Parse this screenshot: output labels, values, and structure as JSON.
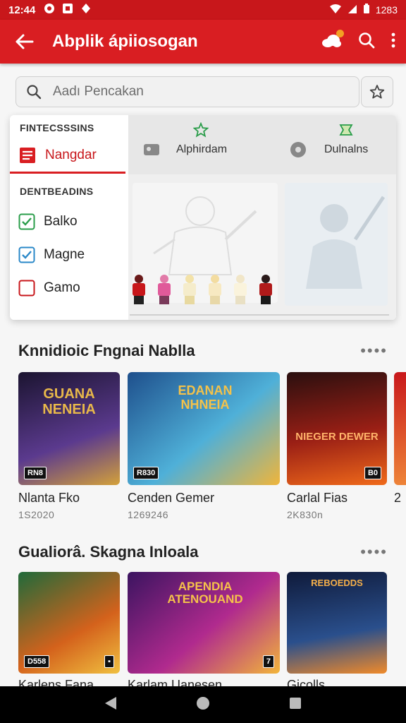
{
  "status": {
    "time": "12:44",
    "battery": "1283"
  },
  "appbar": {
    "title": "Abplik ápiiosogan"
  },
  "search": {
    "placeholder": "Aadı Pencakan"
  },
  "menu": {
    "section1": "FINTECSSSINS",
    "active_item": "Nangdar",
    "section2": "DENTBEADINS",
    "items": [
      {
        "label": "Balko",
        "state": "checked-green"
      },
      {
        "label": "Magne",
        "state": "checked-blue"
      },
      {
        "label": "Gamo",
        "state": "unchecked"
      }
    ],
    "tabs": [
      "Alphirdam",
      "Dulnalns"
    ]
  },
  "sections": [
    {
      "title": "Knnidioic Fngnai Nablla",
      "more": "••••",
      "cards": [
        {
          "name": "Nlanta Fko",
          "count": "1S2020",
          "badge": "RN8",
          "art": "GUANA NENEIA",
          "colors": [
            "#1b1430",
            "#5b3a8e",
            "#d4a13a"
          ]
        },
        {
          "name": "Cenden Gemer",
          "count": "1269246",
          "badge": "R830",
          "art": "EDANAN NHNEIA",
          "colors": [
            "#1e4f8c",
            "#4fb0d8",
            "#f0b53a"
          ]
        },
        {
          "name": "Carlal Fias",
          "count": "2K830n",
          "badge": "B0",
          "art": "NIEGER DEWER",
          "colors": [
            "#2a0f0f",
            "#9a1f15",
            "#f06a1a"
          ]
        },
        {
          "name": "2",
          "count": "",
          "badge": "",
          "art": "",
          "colors": [
            "#c8171b",
            "#e24a2a",
            "#f08a3a"
          ]
        }
      ]
    },
    {
      "title": "Gualiorâ. Skagna Inloala",
      "more": "••••",
      "cards": [
        {
          "name": "Karlens Fana",
          "count": "",
          "badge": "D558",
          "art": "",
          "colors": [
            "#1f6a3a",
            "#d4621c",
            "#f0c040"
          ]
        },
        {
          "name": "Karlam Uanesen",
          "count": "",
          "badge": "7",
          "art": "APENDIA ATENOUAND",
          "colors": [
            "#3b1460",
            "#b02a8e",
            "#f2b53a"
          ]
        },
        {
          "name": "Gicolls",
          "count": "",
          "badge": "",
          "art": "REBOEDDS",
          "colors": [
            "#0f1a3a",
            "#2a4f8c",
            "#f08a2a"
          ]
        }
      ]
    }
  ],
  "colors": {
    "primary": "#d91e22",
    "statusbar": "#c8171b"
  }
}
